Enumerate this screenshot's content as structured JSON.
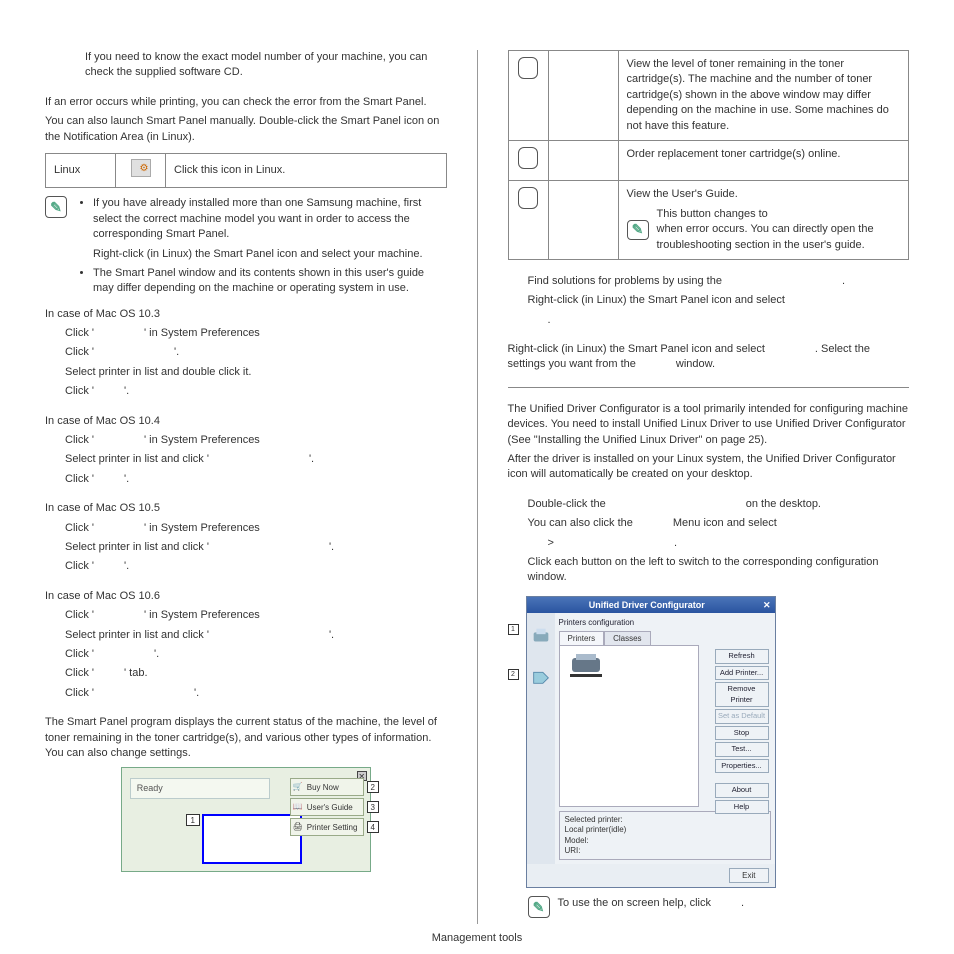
{
  "left": {
    "intro1": "If you need to know the exact model number of your machine, you can check the supplied software CD.",
    "intro2": "If an error occurs while printing, you can check the error from the Smart Panel.",
    "intro3": "You can also launch Smart Panel manually. Double-click the Smart Panel icon on the Notification Area (in Linux).",
    "linux_table": {
      "os": "Linux",
      "desc": "Click this icon in Linux."
    },
    "note_items": [
      "If you have already installed more than one Samsung machine, first select the correct machine model you want in order to access the corresponding Smart Panel.",
      "Right-click (in Linux) the Smart Panel icon and select your machine.",
      "The Smart Panel window and its contents shown in this user's guide may differ depending on the machine or operating system in use."
    ],
    "mac103": {
      "h": "In  case of  Mac OS 10.3",
      "l1a": "Click '",
      "l1b": "' in System Preferences",
      "l2a": "Click '",
      "l2b": "'.",
      "l3": "Select printer in list and double click it.",
      "l4a": "Click '",
      "l4b": "'."
    },
    "mac104": {
      "h": "In  case of  Mac OS 10.4",
      "l1a": "Click '",
      "l1b": "' in System Preferences",
      "l2a": "Select printer in list and click '",
      "l2b": "'.",
      "l3a": "Click '",
      "l3b": "'."
    },
    "mac105": {
      "h": "In  case of  Mac OS 10.5",
      "l1a": "Click '",
      "l1b": "' in System Preferences",
      "l2a": "Select printer in list and click '",
      "l2b": "'.",
      "l3a": "Click '",
      "l3b": "'."
    },
    "mac106": {
      "h": "In  case of  Mac OS 10.6",
      "l1a": "Click '",
      "l1b": "' in System Preferences",
      "l2a": "Select printer in list and click '",
      "l2b": "'.",
      "l3a": "Click '",
      "l3b": "'.",
      "l4a": "Click '",
      "l4b": "' tab.",
      "l5a": "Click '",
      "l5b": "'."
    },
    "sp_desc": "The Smart Panel program displays the current status of the machine, the level of toner remaining in the toner cartridge(s), and various other types of information. You can also change settings.",
    "sp_window": {
      "status": "Ready",
      "btn1": "Buy Now",
      "btn2": "User's Guide",
      "btn3": "Printer Setting",
      "n1": "1",
      "n2": "2",
      "n3": "3",
      "n4": "4"
    }
  },
  "right": {
    "table": {
      "r1": "View the level of toner remaining in the toner cartridge(s). The machine and the number of toner cartridge(s) shown in the above window may differ depending on the machine in use. Some machines do not have this feature.",
      "r2": "Order replacement toner cartridge(s) online.",
      "r3a": "View the User's Guide.",
      "r3b": "This button changes to",
      "r3c": "when error occurs. You can directly open the troubleshooting section in the user's guide."
    },
    "p1a": "Find solutions for problems by using the",
    "p1b": ".",
    "p2a": "Right-click (in Linux) the Smart Panel icon and select",
    "p2b": ".",
    "p3a": "Right-click (in Linux) the Smart Panel icon and select",
    "p3b": ". Select the settings you want from the",
    "p3c": "window.",
    "cfg_intro": "The Unified Driver Configurator is a tool primarily intended for configuring machine devices. You need to install Unified Linux Driver to use Unified Driver Configurator (See \"Installing the Unified Linux Driver\" on page 25).",
    "cfg_intro2": "After the driver is installed on your Linux system, the Unified Driver Configurator icon will automatically be created on your desktop.",
    "open_l1a": "Double-click the",
    "open_l1b": "on the desktop.",
    "open_l2a": "You can also click the",
    "open_l2b": "Menu icon and select",
    "open_l3a": ">",
    "open_l3b": ".",
    "open_l4": "Click each button on the left to switch to the corresponding configuration window.",
    "cfg_window": {
      "title": "Unified Driver Configurator",
      "label": "Printers configuration",
      "tab1": "Printers",
      "tab2": "Classes",
      "btns": [
        "Refresh",
        "Add Printer...",
        "Remove Printer",
        "Set as Default",
        "Stop",
        "Test...",
        "Properties...",
        "About",
        "Help"
      ],
      "bottom_h": "Selected printer:",
      "bottom_1": "Local printer(idle)",
      "bottom_2": "Model:",
      "bottom_3": "URI:",
      "exit": "Exit",
      "n1": "1",
      "n2": "2"
    },
    "help_note": "To use the on screen help, click",
    "help_note_end": "."
  },
  "footer": "Management tools"
}
